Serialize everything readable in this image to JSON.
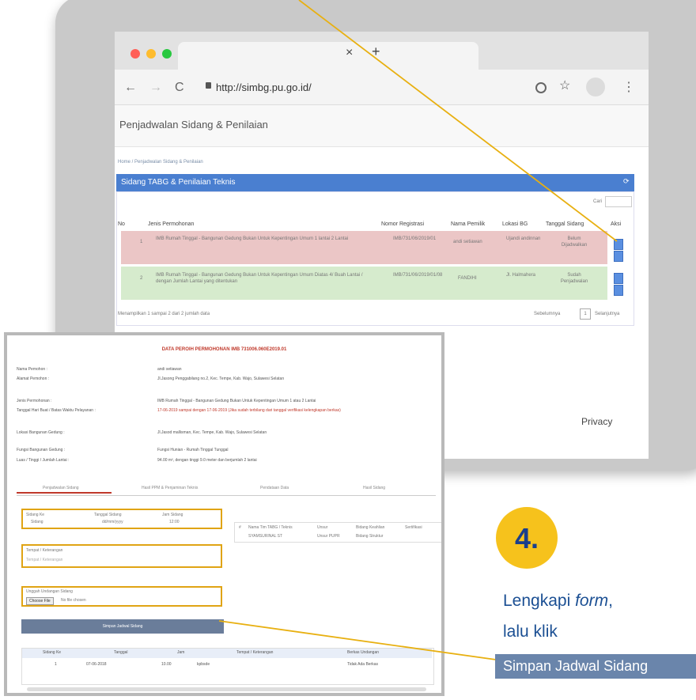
{
  "browser": {
    "url": "http://simbg.pu.go.id/",
    "close_glyph": "×",
    "newtab_glyph": "+",
    "back_glyph": "←",
    "forward_glyph": "→",
    "reload_glyph": "C",
    "menu_glyph": "⋮"
  },
  "app": {
    "title": "Penjadwalan Sidang & Penilaian",
    "breadcrumb": "Home / Penjadwalan Sidang & Penilaian",
    "panel_title": "Sidang TABG & Penilaian Teknis",
    "search_label": "Cari",
    "columns": [
      "No",
      "Jenis Permohonan",
      "Nomor Registrasi",
      "Nama Pemilik",
      "Lokasi BG",
      "Tanggal Sidang",
      "Aksi"
    ],
    "rows": [
      {
        "no": "1",
        "jenis": "IMB Rumah Tinggal - Bangunan Gedung Bukan Untuk Kepentingan Umum 1 lantai 2 Lantai",
        "reg": "IMB/731/06/2019/01",
        "pemilik": "andi setiawan",
        "lokasi": "Ujandi andinnan",
        "tanggal": "Belum Dijadwalkan"
      },
      {
        "no": "2",
        "jenis": "IMB Rumah Tinggal - Bangunan Gedung Bukan Untuk Kepentingan Umum Diatas 4/ Buah Lantai / dengan Jumlah Lantai yang ditentukan",
        "reg": "IMB/731/06/2019/01/08",
        "pemilik": "FANDIHI",
        "lokasi": "Jl. Halmahera",
        "tanggal": "Sudah Penjadwalan"
      }
    ],
    "footer_info": "Menampilkan 1 sampai 2 dari 2 jumlah data",
    "pagination_prev": "Sebelumnya",
    "pagination_page": "1",
    "pagination_next": "Selanjutnya",
    "privacy": "Privacy"
  },
  "form": {
    "title": "DATA PEROIH PERMOHONAN IMB 731006.060E2019.01",
    "fields": [
      {
        "label": "Nama Pemohon :",
        "value": "andi setiawan"
      },
      {
        "label": "Alamat Pemohon :",
        "value": "Jl.Jasong Penggabilang no.2, Kec. Tempe, Kab. Wajo, Sulawesi Selatan"
      },
      {
        "label": "Jenis Permohonan :",
        "value": "IMB Rumah Tinggal - Bangunan Gedung Bukan Untuk Kepentingan Umum 1 atau 2 Lantai"
      },
      {
        "label": "Tanggal Hari Buat / Batas Waktu Pelayanan :",
        "value": "17-06-2019 sampai dengan 17-06-2019 (Jika sudah terbilang dari tanggal verifikasi kelengkapan berkas)"
      },
      {
        "label": "Lokasi Bangunan Gedung :",
        "value": "Jl.Jasod mallisman, Kec. Tempe, Kab. Wajo, Sulawesi Selatan"
      },
      {
        "label": "Fungsi Bangunan Gedung :",
        "value": "Fungsi Hunian - Rumah Tinggal Tunggal"
      },
      {
        "label": "Luas / Tinggi / Jumlah Lantai :",
        "value": "94.00 m², dengan tinggi 9.0 meter dan berjumlah 2 lantai"
      }
    ],
    "tabs": [
      "Penjadwalan Sidang",
      "Hasil PPM & Penjaminan Teknis",
      "Pendataan Data",
      "Hasil Sidang"
    ],
    "sidang_ke_label": "Sidang Ke",
    "sidang_ke_value": "Sidang",
    "tanggal_label": "Tanggal Sidang",
    "tanggal_value": "dd/mm/yyyy",
    "jam_label": "Jam Sidang",
    "jam_value": "12:00",
    "tempat_label": "Tempat / Keterangan",
    "tempat_placeholder": "Tempat / Keterangan",
    "undangan_label": "Unggah Undangan Sidang",
    "choose_file": "Choose File",
    "no_file": "No file chosen",
    "simpan_button": "Simpan Jadwal Sidang",
    "tim_headers": [
      "#",
      "Nama Tim TABG / Teknis",
      "Unsur",
      "Bidang Keahlian",
      "Sertifikasi"
    ],
    "tim_row": [
      "",
      "SYAMSURINAL ST",
      "Unsur PUPR",
      "Bidang Struktur",
      ""
    ],
    "bottom_headers": [
      "Sidang Ke",
      "Tanggal",
      "Jam",
      "Tempat / Keterangan",
      "Berkas Undangan"
    ],
    "bottom_row": [
      "1",
      "07-06-2018",
      "10.00",
      "kpbsde",
      "Tidak Ada Berkas"
    ]
  },
  "callout": {
    "step_number": "4.",
    "line1_a": "Lengkapi ",
    "line1_b": "form",
    "line1_c": ",",
    "line2": "lalu klik",
    "button_text": "Simpan Jadwal Sidang"
  },
  "colors": {
    "accent_yellow": "#f6c21c",
    "text_blue": "#1b4f93",
    "panel_blue": "#4a7fd0",
    "row_red": "#ebc6c6",
    "row_green": "#d6ebcd",
    "highlight_box": "#e0a414"
  }
}
